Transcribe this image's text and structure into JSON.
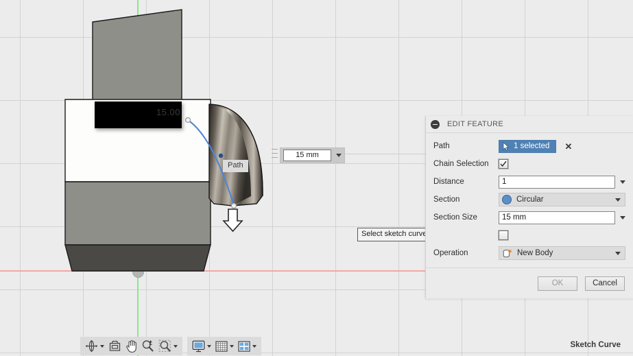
{
  "app": {
    "status_text": "Sketch Curve"
  },
  "canvas": {
    "path_label": "Path",
    "dimension_value": "15 mm",
    "hidden_dimension": "15.00",
    "select_hint": "Select sketch curves or edges",
    "axis_x_color": "#f2a8a4",
    "axis_y_color": "#8ce58c",
    "background_color": "#ececec",
    "grid_color": "#d2d2d2",
    "path_curve_color": "#4a86d8"
  },
  "dialog": {
    "title": "EDIT FEATURE",
    "collapse_icon": "minus-circle-icon",
    "rows": [
      {
        "label": "Path",
        "type": "selection",
        "value": "1 selected",
        "icon": "cursor-arrow-icon",
        "clear": "✕",
        "accent": "#4f81b4"
      },
      {
        "label": "Chain Selection",
        "type": "checkbox",
        "checked": true
      },
      {
        "label": "Distance",
        "type": "text",
        "value": "1"
      },
      {
        "label": "Section",
        "type": "dropdown",
        "value": "Circular",
        "icon": "blue-circle-icon"
      },
      {
        "label": "Section Size",
        "type": "text",
        "value": "15 mm"
      },
      {
        "label": "",
        "type": "checkbox",
        "checked": false
      },
      {
        "label": "Operation",
        "type": "dropdown",
        "value": "New Body",
        "icon": "new-body-icon"
      }
    ],
    "ok_label": "OK",
    "cancel_label": "Cancel"
  },
  "toolbar": {
    "groups": [
      {
        "items": [
          {
            "name": "orbit-icon",
            "label": "Orbit",
            "has_caret": true
          },
          {
            "name": "look-at-icon",
            "label": "Look At",
            "has_caret": false
          },
          {
            "name": "pan-icon",
            "label": "Pan",
            "has_caret": false
          },
          {
            "name": "zoom-icon",
            "label": "Zoom",
            "has_caret": false
          },
          {
            "name": "zoom-window-icon",
            "label": "Fit",
            "has_caret": true
          }
        ]
      },
      {
        "items": [
          {
            "name": "display-settings-icon",
            "label": "Display Settings",
            "has_caret": true
          },
          {
            "name": "grid-snaps-icon",
            "label": "Grid and Snaps",
            "has_caret": true
          },
          {
            "name": "viewports-icon",
            "label": "Viewports",
            "has_caret": true
          }
        ]
      }
    ]
  }
}
